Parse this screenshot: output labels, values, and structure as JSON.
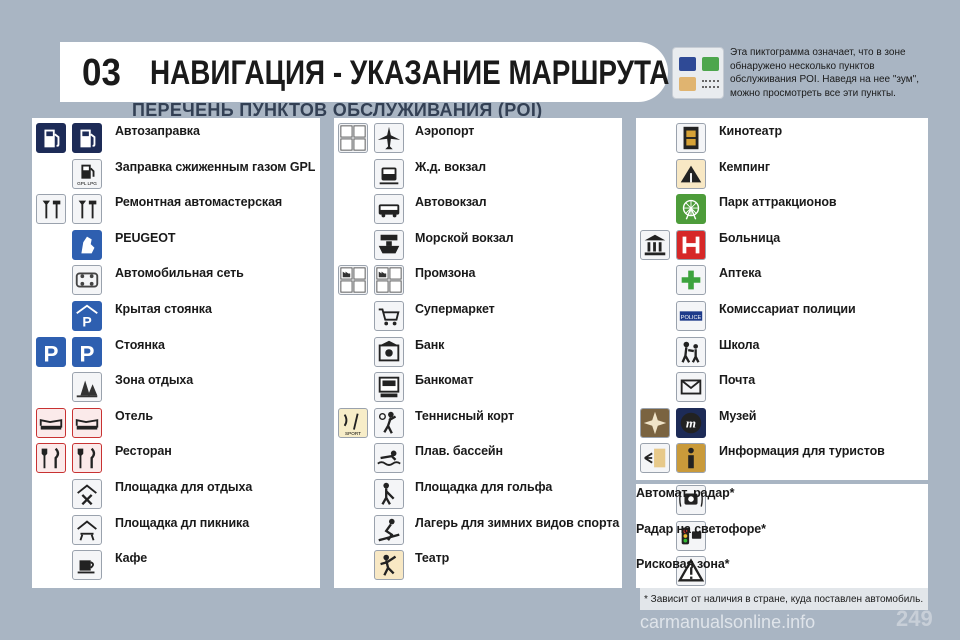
{
  "header": {
    "chapter": "03",
    "title": "НАВИГАЦИЯ - УКАЗАНИЕ МАРШРУТА",
    "subtitle": "ПЕРЕЧЕНЬ ПУНКТОВ ОБСЛУЖИВАНИЯ (POI)",
    "note": "Эта пиктограмма означает, что в зоне обнаружено несколько пунктов обслуживания POI. Наведя на нее \"зум\", можно просмотреть все эти пункты."
  },
  "col1": [
    {
      "label": "Автозаправка",
      "icons": [
        "fuel-station-icon",
        "fuel-station-icon"
      ]
    },
    {
      "label": "Заправка сжиженным газом GPL",
      "icons": [
        "gpl-fuel-icon"
      ]
    },
    {
      "label": "Ремонтная автомастерская",
      "icons": [
        "repair-tools-icon",
        "repair-tools-icon"
      ]
    },
    {
      "label": "PEUGEOT",
      "icons": [
        "peugeot-lion-icon"
      ]
    },
    {
      "label": "Автомобильная сеть",
      "icons": [
        "car-network-icon"
      ]
    },
    {
      "label": "Крытая стоянка",
      "icons": [
        "covered-parking-icon"
      ]
    },
    {
      "label": "Стоянка",
      "icons": [
        "parking-icon",
        "parking-icon"
      ]
    },
    {
      "label": "Зона отдыха",
      "icons": [
        "rest-area-icon"
      ]
    },
    {
      "label": "Отель",
      "icons": [
        "hotel-bed-icon",
        "hotel-bed-icon"
      ]
    },
    {
      "label": "Ресторан",
      "icons": [
        "restaurant-icon",
        "restaurant-icon"
      ]
    },
    {
      "label": "Площадка для отдыха",
      "icons": [
        "rest-stop-icon"
      ]
    },
    {
      "label": "Площадка дл пикника",
      "icons": [
        "picnic-icon"
      ]
    },
    {
      "label": "Кафе",
      "icons": [
        "cafe-cup-icon"
      ]
    }
  ],
  "col2": [
    {
      "label": "Аэропорт",
      "icons": [
        "airport-multi-icon",
        "airplane-icon"
      ]
    },
    {
      "label": "Ж.д. вокзал",
      "icons": [
        "train-station-icon"
      ]
    },
    {
      "label": "Автовокзал",
      "icons": [
        "bus-station-icon"
      ]
    },
    {
      "label": "Морской вокзал",
      "icons": [
        "ferry-terminal-icon"
      ]
    },
    {
      "label": "Промзона",
      "icons": [
        "industrial-zone-icon",
        "industrial-zone-icon"
      ]
    },
    {
      "label": "Супермаркет",
      "icons": [
        "shopping-cart-icon"
      ]
    },
    {
      "label": "Банк",
      "icons": [
        "bank-icon"
      ]
    },
    {
      "label": "Банкомат",
      "icons": [
        "atm-icon"
      ]
    },
    {
      "label": "Теннисный корт",
      "icons": [
        "sport-multi-icon",
        "tennis-icon"
      ]
    },
    {
      "label": "Плав. бассейн",
      "icons": [
        "swimming-pool-icon"
      ]
    },
    {
      "label": "Площадка для гольфа",
      "icons": [
        "golf-icon"
      ]
    },
    {
      "label": "Лагерь для зимних видов спорта",
      "icons": [
        "ski-icon"
      ]
    },
    {
      "label": "Театр",
      "icons": [
        "theatre-icon"
      ]
    }
  ],
  "col3": [
    {
      "label": "Кинотеатр",
      "icons": [
        "cinema-film-icon"
      ]
    },
    {
      "label": "Кемпинг",
      "icons": [
        "camping-icon"
      ]
    },
    {
      "label": "Парк аттракционов",
      "icons": [
        "amusement-park-icon"
      ]
    },
    {
      "label": "Больница",
      "icons": [
        "hospital-building-icon",
        "hospital-h-icon"
      ]
    },
    {
      "label": "Аптека",
      "icons": [
        "pharmacy-cross-icon"
      ]
    },
    {
      "label": "Комиссариат полиции",
      "icons": [
        "police-icon"
      ]
    },
    {
      "label": "Школа",
      "icons": [
        "school-children-icon"
      ]
    },
    {
      "label": "Почта",
      "icons": [
        "post-envelope-icon"
      ]
    },
    {
      "label": "Музей",
      "icons": [
        "museum-compass-icon",
        "museum-m-icon"
      ]
    },
    {
      "label": "Информация для туристов",
      "icons": [
        "tourist-multi-icon",
        "tourist-info-icon"
      ]
    },
    {
      "label": "Автомат. радар*",
      "icons": [
        "speed-radar-icon"
      ]
    },
    {
      "label": "Радар на светофоре*",
      "icons": [
        "traffic-light-radar-icon"
      ]
    },
    {
      "label": "Рисковая зона*",
      "icons": [
        "risk-zone-icon"
      ]
    }
  ],
  "footnote": "* Зависит от наличия в стране, куда поставлен автомобиль.",
  "page_number": "249",
  "watermark": "carmanualsonline.info",
  "colors": {
    "background": "#a9b5c3",
    "panel": "#ffffff",
    "accent_dark": "#1d2b57",
    "accent_red": "#c83232",
    "accent_blue": "#2e5fb0",
    "accent_green": "#4d9c3a"
  }
}
